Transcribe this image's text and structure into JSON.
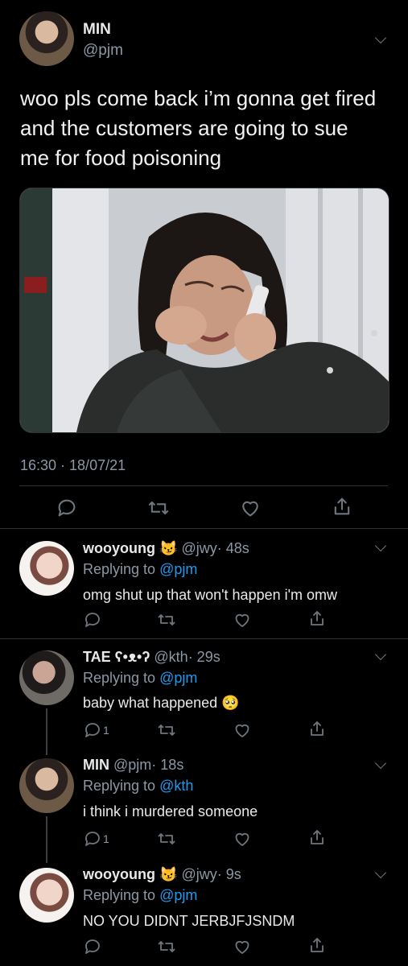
{
  "main_tweet": {
    "name": "MIN",
    "handle": "@pjm",
    "text_lines": [
      "woo pls come back i’m gonna get fired",
      "and the customers are going to sue",
      "me for food poisoning"
    ],
    "timestamp": "16:30 · 18/07/21"
  },
  "replies": [
    {
      "name": "wooyoung",
      "emoji": "😼",
      "handle": "@jwy",
      "time": "· 48s",
      "replying_prefix": "Replying to ",
      "replying_to": "@pjm",
      "text": "omg shut up that won't happen i'm omw",
      "reply_count": ""
    },
    {
      "name": "TAE ʕ•ᴥ•ʔ",
      "emoji": "",
      "handle": "@kth",
      "time": "· 29s",
      "replying_prefix": "Replying to ",
      "replying_to": "@pjm",
      "text": "baby what happened 🥺",
      "reply_count": "1"
    },
    {
      "name": "MIN",
      "emoji": "",
      "handle": "@pjm",
      "time": "· 18s",
      "replying_prefix": "Replying to ",
      "replying_to": "@kth",
      "text": "i think i murdered someone",
      "reply_count": "1"
    },
    {
      "name": "wooyoung",
      "emoji": "😼",
      "handle": "@jwy",
      "time": "· 9s",
      "replying_prefix": "Replying to ",
      "replying_to": "@pjm",
      "text": "NO YOU DIDNT JERBJFJSNDM",
      "reply_count": ""
    }
  ],
  "icons": [
    "reply-icon",
    "retweet-icon",
    "like-icon",
    "share-icon",
    "chevron-down-icon"
  ],
  "colors": {
    "background": "#000000",
    "text": "#e7e9ea",
    "muted": "#8b98a5",
    "link": "#1d9bf0",
    "divider": "#2f3336"
  }
}
